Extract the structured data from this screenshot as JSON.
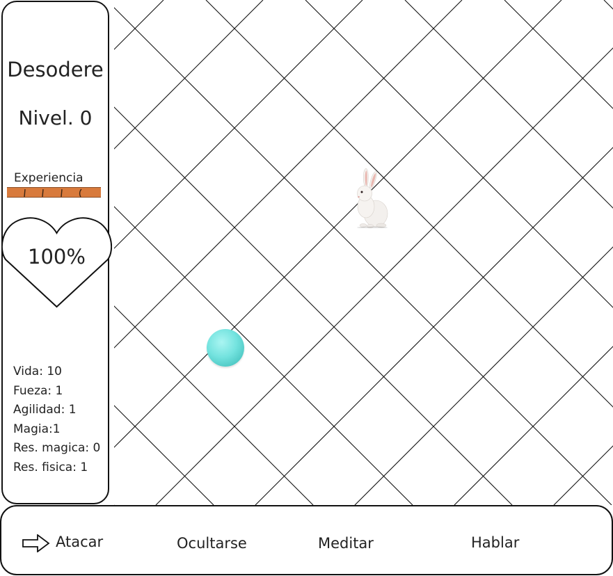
{
  "character": {
    "name": "Desodere",
    "level": "Nivel. 0",
    "experience_label": "Experiencia",
    "health_percent": "100%"
  },
  "stats": [
    "Vida: 10",
    "Fueza: 1",
    "Agilidad: 1",
    "Magia:1",
    "Res. magica: 0",
    "Res. fisica: 1"
  ],
  "actions": {
    "attack": "Atacar",
    "hide": "Ocultarse",
    "meditate": "Meditar",
    "talk": "Hablar"
  },
  "board": {
    "player": {
      "icon": "cyan-orb",
      "color": "#6fdedb"
    },
    "enemy": {
      "icon": "white-rabbit"
    }
  },
  "colors": {
    "experience_bar": "#d87a3c",
    "border": "#111111"
  }
}
